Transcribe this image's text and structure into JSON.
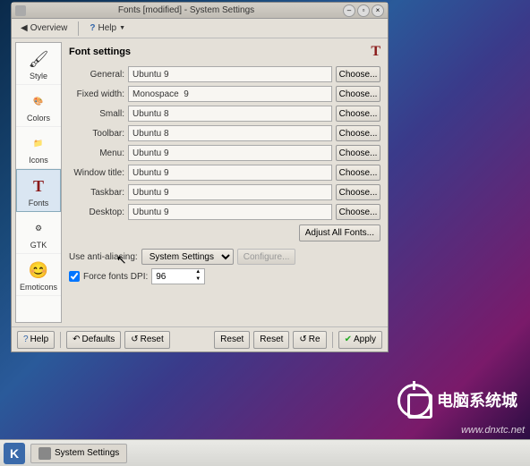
{
  "window": {
    "title": "Fonts [modified] - System Settings",
    "overview": "Overview",
    "help": "Help"
  },
  "sidebar": {
    "items": [
      {
        "label": "Style",
        "icon": "🖌"
      },
      {
        "label": "Colors",
        "icon": "🎨"
      },
      {
        "label": "Icons",
        "icon": "📁"
      },
      {
        "label": "Fonts",
        "icon": "T"
      },
      {
        "label": "GTK",
        "icon": "⚙"
      },
      {
        "label": "Emoticons",
        "icon": "😊"
      }
    ],
    "selected": 3
  },
  "main": {
    "title": "Font settings",
    "choose_label": "Choose...",
    "rows": [
      {
        "label": "General:",
        "value": "Ubuntu 9"
      },
      {
        "label": "Fixed width:",
        "value": "Monospace  9"
      },
      {
        "label": "Small:",
        "value": "Ubuntu 8"
      },
      {
        "label": "Toolbar:",
        "value": "Ubuntu 8"
      },
      {
        "label": "Menu:",
        "value": "Ubuntu 9"
      },
      {
        "label": "Window title:",
        "value": "Ubuntu 9"
      },
      {
        "label": "Taskbar:",
        "value": "Ubuntu 9"
      },
      {
        "label": "Desktop:",
        "value": "Ubuntu 9"
      }
    ],
    "adjust_all": "Adjust All Fonts...",
    "aa_label": "Use anti-aliasing:",
    "aa_value": "System Settings",
    "configure": "Configure...",
    "dpi_label": "Force fonts DPI:",
    "dpi_checked": true,
    "dpi_value": "96"
  },
  "footer": {
    "help": "Help",
    "defaults": "Defaults",
    "reset": "Reset",
    "apply": "Apply"
  },
  "taskbar": {
    "system_settings": "System Settings"
  },
  "branding": {
    "name": "电脑系统城",
    "url": "www.dnxtc.net"
  }
}
